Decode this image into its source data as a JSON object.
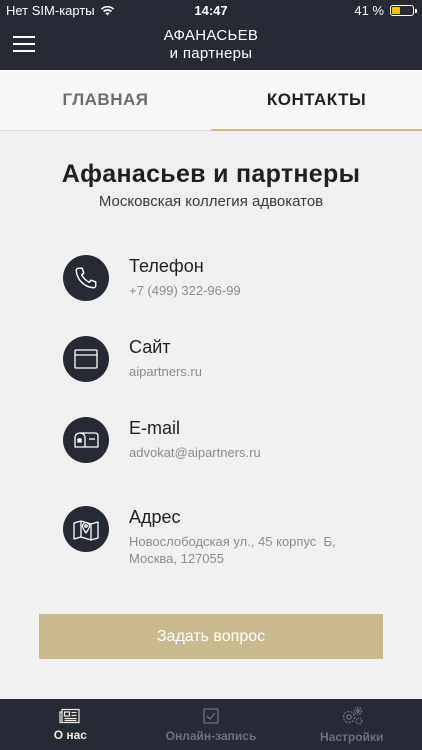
{
  "status_bar": {
    "carrier": "Нет SIM-карты",
    "time": "14:47",
    "battery": "41 %",
    "battery_level": 0.41
  },
  "header": {
    "title_line1": "АФАНАСЬЕВ",
    "title_line2": "и партнеры"
  },
  "tabs": [
    {
      "label": "ГЛАВНАЯ",
      "active": false
    },
    {
      "label": "КОНТАКТЫ",
      "active": true
    }
  ],
  "company": {
    "name": "Афанасьев и партнеры",
    "subtitle": "Московская коллегия адвокатов"
  },
  "contacts": [
    {
      "label": "Телефон",
      "value": "+7 (499) 322-96-99",
      "icon": "phone-icon"
    },
    {
      "label": "Сайт",
      "value": "aipartners.ru",
      "icon": "browser-window-icon"
    },
    {
      "label": "E-mail",
      "value": "advokat@aipartners.ru",
      "icon": "mailbox-icon"
    },
    {
      "label": "Адрес",
      "value_line1": "Новослободская ул., 45 корпус  Б,",
      "value_line2": "Москва, 127055",
      "icon": "map-icon"
    }
  ],
  "ask_button": {
    "label": "Задать вопрос"
  },
  "bottom_nav": [
    {
      "label": "О нас",
      "icon": "newspaper-icon",
      "active": true
    },
    {
      "label": "Онлайн-запись",
      "icon": "checkbox-icon",
      "active": false
    },
    {
      "label": "Настройки",
      "icon": "gears-icon",
      "active": false
    }
  ],
  "colors": {
    "dark": "#262a35",
    "accent": "#c9b98f",
    "background": "#f0f0f0"
  }
}
